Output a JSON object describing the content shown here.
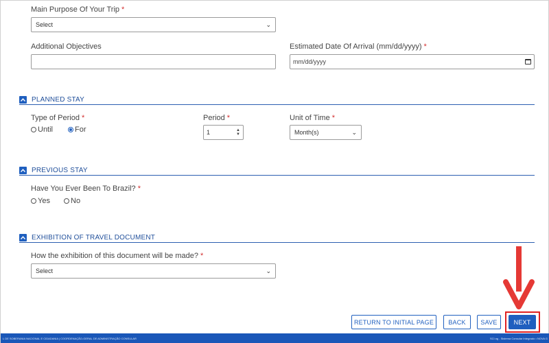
{
  "trip_purpose": {
    "label": "Main Purpose Of Your Trip",
    "required_mark": "*",
    "value": "Select"
  },
  "additional_objectives": {
    "label": "Additional Objectives",
    "value": ""
  },
  "arrival_date": {
    "label": "Estimated Date Of Arrival (mm/dd/yyyy)",
    "required_mark": "*",
    "placeholder": "mm/dd/yyyy"
  },
  "planned_stay": {
    "title": "PLANNED STAY",
    "type_label": "Type of Period",
    "required_mark": "*",
    "options": [
      "Until",
      "For"
    ],
    "selected": "For",
    "period_label": "Period",
    "period_value": "1",
    "unit_label": "Unit of Time",
    "unit_value": "Month(s)"
  },
  "previous_stay": {
    "title": "PREVIOUS STAY",
    "question": "Have You Ever Been To Brazil?",
    "required_mark": "*",
    "options": [
      "Yes",
      "No"
    ]
  },
  "travel_document": {
    "title": "EXHIBITION OF TRAVEL DOCUMENT",
    "question": "How the exhibition of this document will be made?",
    "required_mark": "*",
    "value": "Select"
  },
  "actions": {
    "return": "RETURN TO INITIAL PAGE",
    "back": "BACK",
    "save": "SAVE",
    "next": "NEXT"
  },
  "footer": {
    "left": "L DE SOBERANIA NACIONAL E CIDADANIA | COORDENAÇÃO-GERAL DE ADMINISTRAÇÃO CONSULAR",
    "right": "SCI.ng - Sistema Consular Integrado • NOVA G"
  },
  "colors": {
    "accent": "#1f5fbf",
    "highlight": "#e02020",
    "footer": "#1a57b8"
  }
}
